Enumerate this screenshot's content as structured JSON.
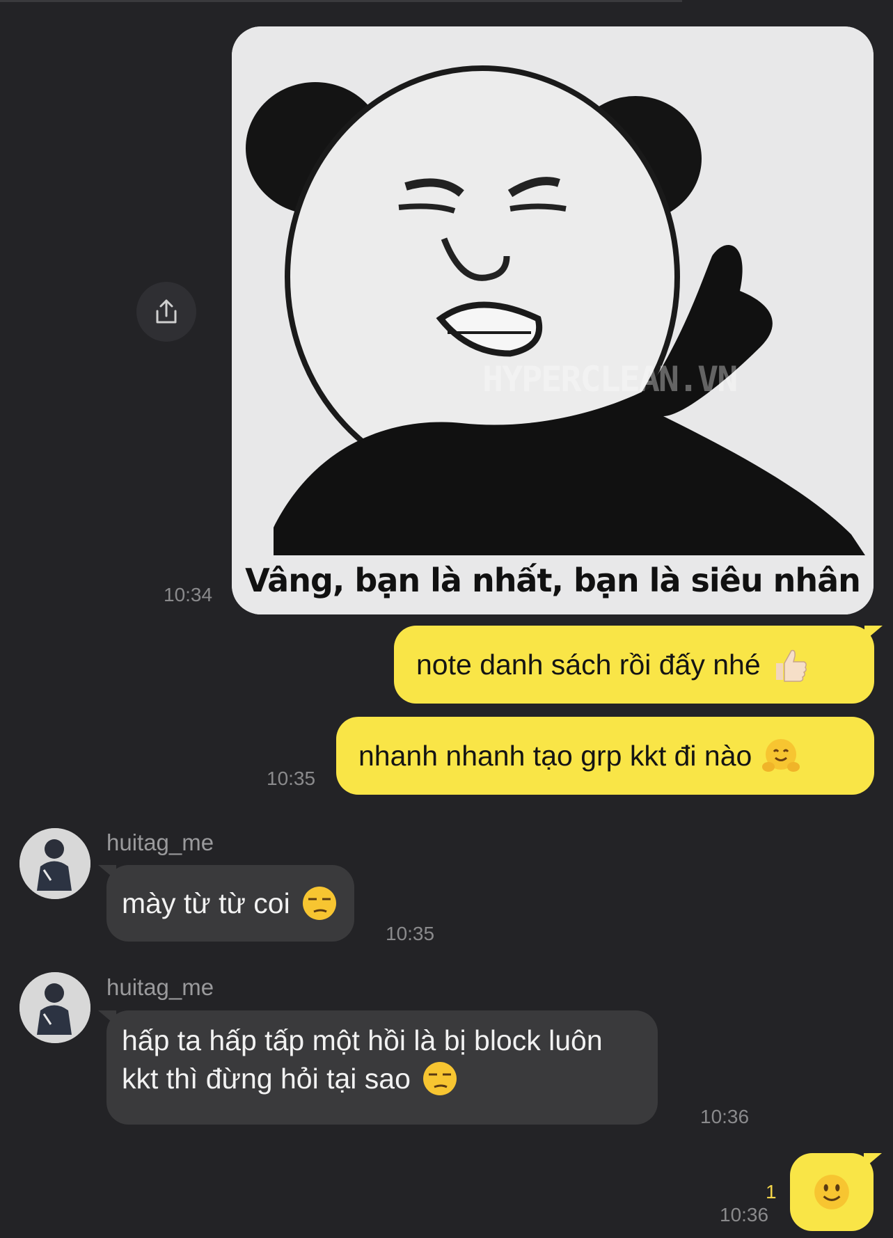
{
  "image_message": {
    "caption": "Vâng, bạn là nhất, bạn là siêu nhân",
    "watermark": "HYPERCLEAN.VN",
    "time": "10:34",
    "share_icon": "share-icon"
  },
  "outgoing": [
    {
      "text": "note danh sách rồi đấy nhé",
      "emoji": "thumbs-up-icon"
    },
    {
      "text": "nhanh nhanh tạo grp kkt đi nào",
      "emoji": "hugging-face-icon",
      "time": "10:35"
    }
  ],
  "incoming": [
    {
      "sender": "huitag_me",
      "text": "mày từ từ coi",
      "emoji": "unamused-face-icon",
      "time": "10:35"
    },
    {
      "sender": "huitag_me",
      "lines": [
        "hấp ta hấp tấp một hồi là bị block luôn",
        "kkt thì đừng hỏi tại sao"
      ],
      "emoji": "unamused-face-icon",
      "time": "10:36"
    }
  ],
  "last_outgoing": {
    "emoji": "slightly-smiling-face-icon",
    "unread_count": "1",
    "time": "10:36"
  },
  "colors": {
    "background": "#232326",
    "outgoing_bubble": "#f9e547",
    "incoming_bubble": "#3a3a3c",
    "timestamp": "#8a8a8c"
  }
}
